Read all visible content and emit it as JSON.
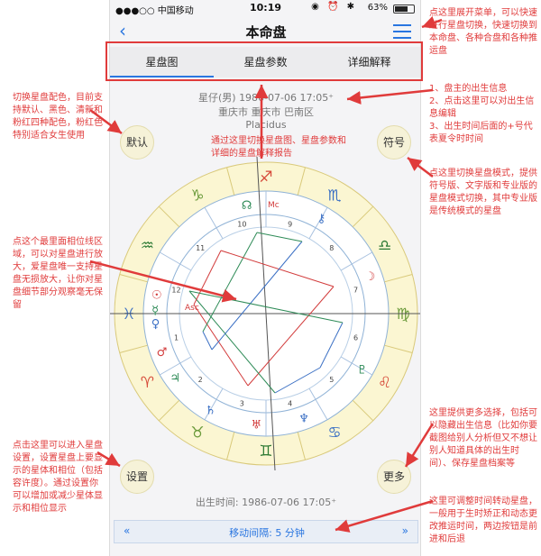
{
  "status_bar": {
    "carrier": "●●●○○ 中国移动",
    "time": "10:19",
    "battery": "63%"
  },
  "nav": {
    "title": "本命盘"
  },
  "tabs": [
    "星盘图",
    "星盘参数",
    "详细解释"
  ],
  "chart_info": {
    "name_line": "星仔(男) 1986-07-06 17:05⁺",
    "place_line": "重庆市 重庆市 巴南区",
    "system": "Placidus"
  },
  "buttons": {
    "default": "默认",
    "symbol": "符号",
    "settings": "设置",
    "more": "更多"
  },
  "birth_time": "出生时间:  1986-07-06 17:05⁺",
  "move_interval": "移动间隔:  5 分钟",
  "move_prev": "«",
  "move_next": "»",
  "colors": {
    "accent": "#2a76e0",
    "annotation": "#e03b3b"
  },
  "annotations": {
    "menu": "点这里展开菜单，可以快速进行星盘切换，快速切换到本命盘、各种合盘和各种推运盘",
    "color_theme": "切换星盘配色，目前支持默认、黑色、清新和粉红四种配色，粉红色特别适合女生使用",
    "owner_info": "1、盘主的出生信息\n2、点击这里可以对出生信息编辑\n3、出生时间后面的+号代表夏令时时间",
    "tab_switch": "通过这里切换星盘图、星盘参数和详细的星盘解释报告",
    "symbol_mode": "点这里切换星盘模式，提供符号版、文字版和专业版的星盘模式切换，其中专业版是传统模式的星盘",
    "zoom": "点这个最里面相位线区域，可以对星盘进行放大，爱星盘唯一支持星盘无损放大，让你对星盘细节部分观察毫无保留",
    "settings": "点击这里可以进入星盘设置，设置星盘上要显示的星体和相位（包括容许度）。通过设置你可以增加或减少星体显示和相位显示",
    "more": "这里提供更多选择，包括可以隐藏出生信息（比如你要截图给别人分析但又不想让别人知道具体的出生时间）、保存星盘档案等",
    "time_adjust": "这里可调整时间转动星盘，一般用于生时矫正和动态更改推运时间，两边按钮是前进和后退"
  },
  "zodiac_glyphs": [
    "♈",
    "♉",
    "♊",
    "♋",
    "♌",
    "♍",
    "♎",
    "♏",
    "♐",
    "♑",
    "♒",
    "♓"
  ],
  "house_numbers": [
    "1",
    "2",
    "3",
    "4",
    "5",
    "6",
    "7",
    "8",
    "9",
    "10",
    "11",
    "12"
  ],
  "chart_labels": {
    "asc": "Asc",
    "mc": "Mc",
    "ic": "Ic",
    "dsc": "Dsc"
  }
}
